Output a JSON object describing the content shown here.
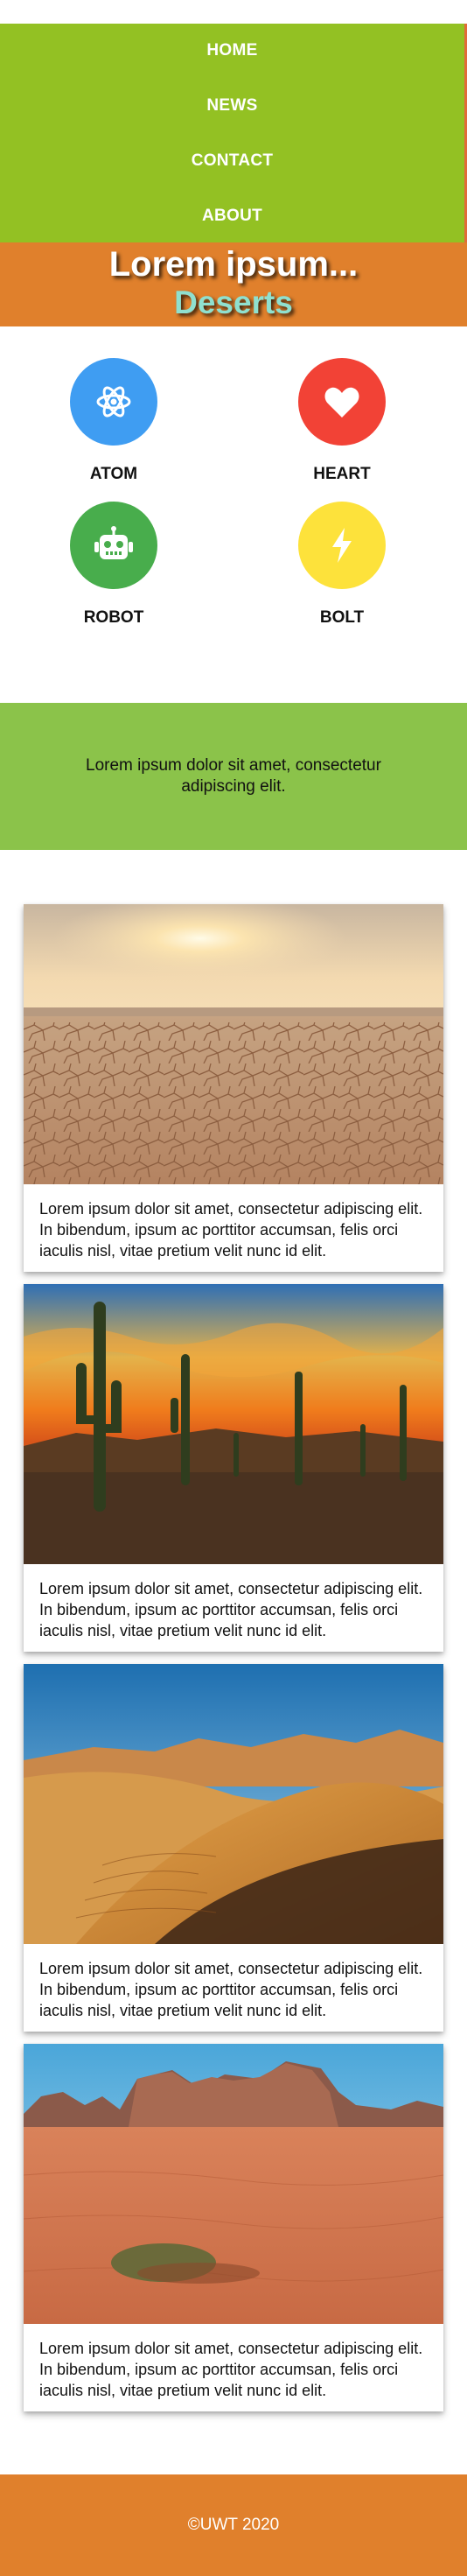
{
  "nav": {
    "items": [
      "HOME",
      "NEWS",
      "CONTACT",
      "ABOUT"
    ]
  },
  "hero": {
    "title": "Lorem ipsum...",
    "subtitle": "Deserts"
  },
  "features": [
    {
      "label": "ATOM",
      "icon": "atom-icon",
      "color": "#3f9df2"
    },
    {
      "label": "HEART",
      "icon": "heart-icon",
      "color": "#f24236"
    },
    {
      "label": "ROBOT",
      "icon": "robot-icon",
      "color": "#48ad4c"
    },
    {
      "label": "BOLT",
      "icon": "bolt-icon",
      "color": "#fde23b"
    }
  ],
  "intro": {
    "text": "Lorem ipsum dolor sit amet, consectetur adipiscing elit."
  },
  "cards": [
    {
      "text": "Lorem ipsum dolor sit amet, consectetur adipiscing elit. In bibendum, ipsum ac porttitor accumsan, felis orci iaculis nisl, vitae pretium velit nunc id elit."
    },
    {
      "text": "Lorem ipsum dolor sit amet, consectetur adipiscing elit. In bibendum, ipsum ac porttitor accumsan, felis orci iaculis nisl, vitae pretium velit nunc id elit."
    },
    {
      "text": "Lorem ipsum dolor sit amet, consectetur adipiscing elit. In bibendum, ipsum ac porttitor accumsan, felis orci iaculis nisl, vitae pretium velit nunc id elit."
    },
    {
      "text": "Lorem ipsum dolor sit amet, consectetur adipiscing elit. In bibendum, ipsum ac porttitor accumsan, felis orci iaculis nisl, vitae pretium velit nunc id elit."
    }
  ],
  "footer": {
    "text": "©UWT 2020"
  },
  "colors": {
    "nav_bg": "#93c123",
    "accent_orange": "#e0802c",
    "band_green": "#8bc34a",
    "subtitle": "#8fe0cf"
  }
}
